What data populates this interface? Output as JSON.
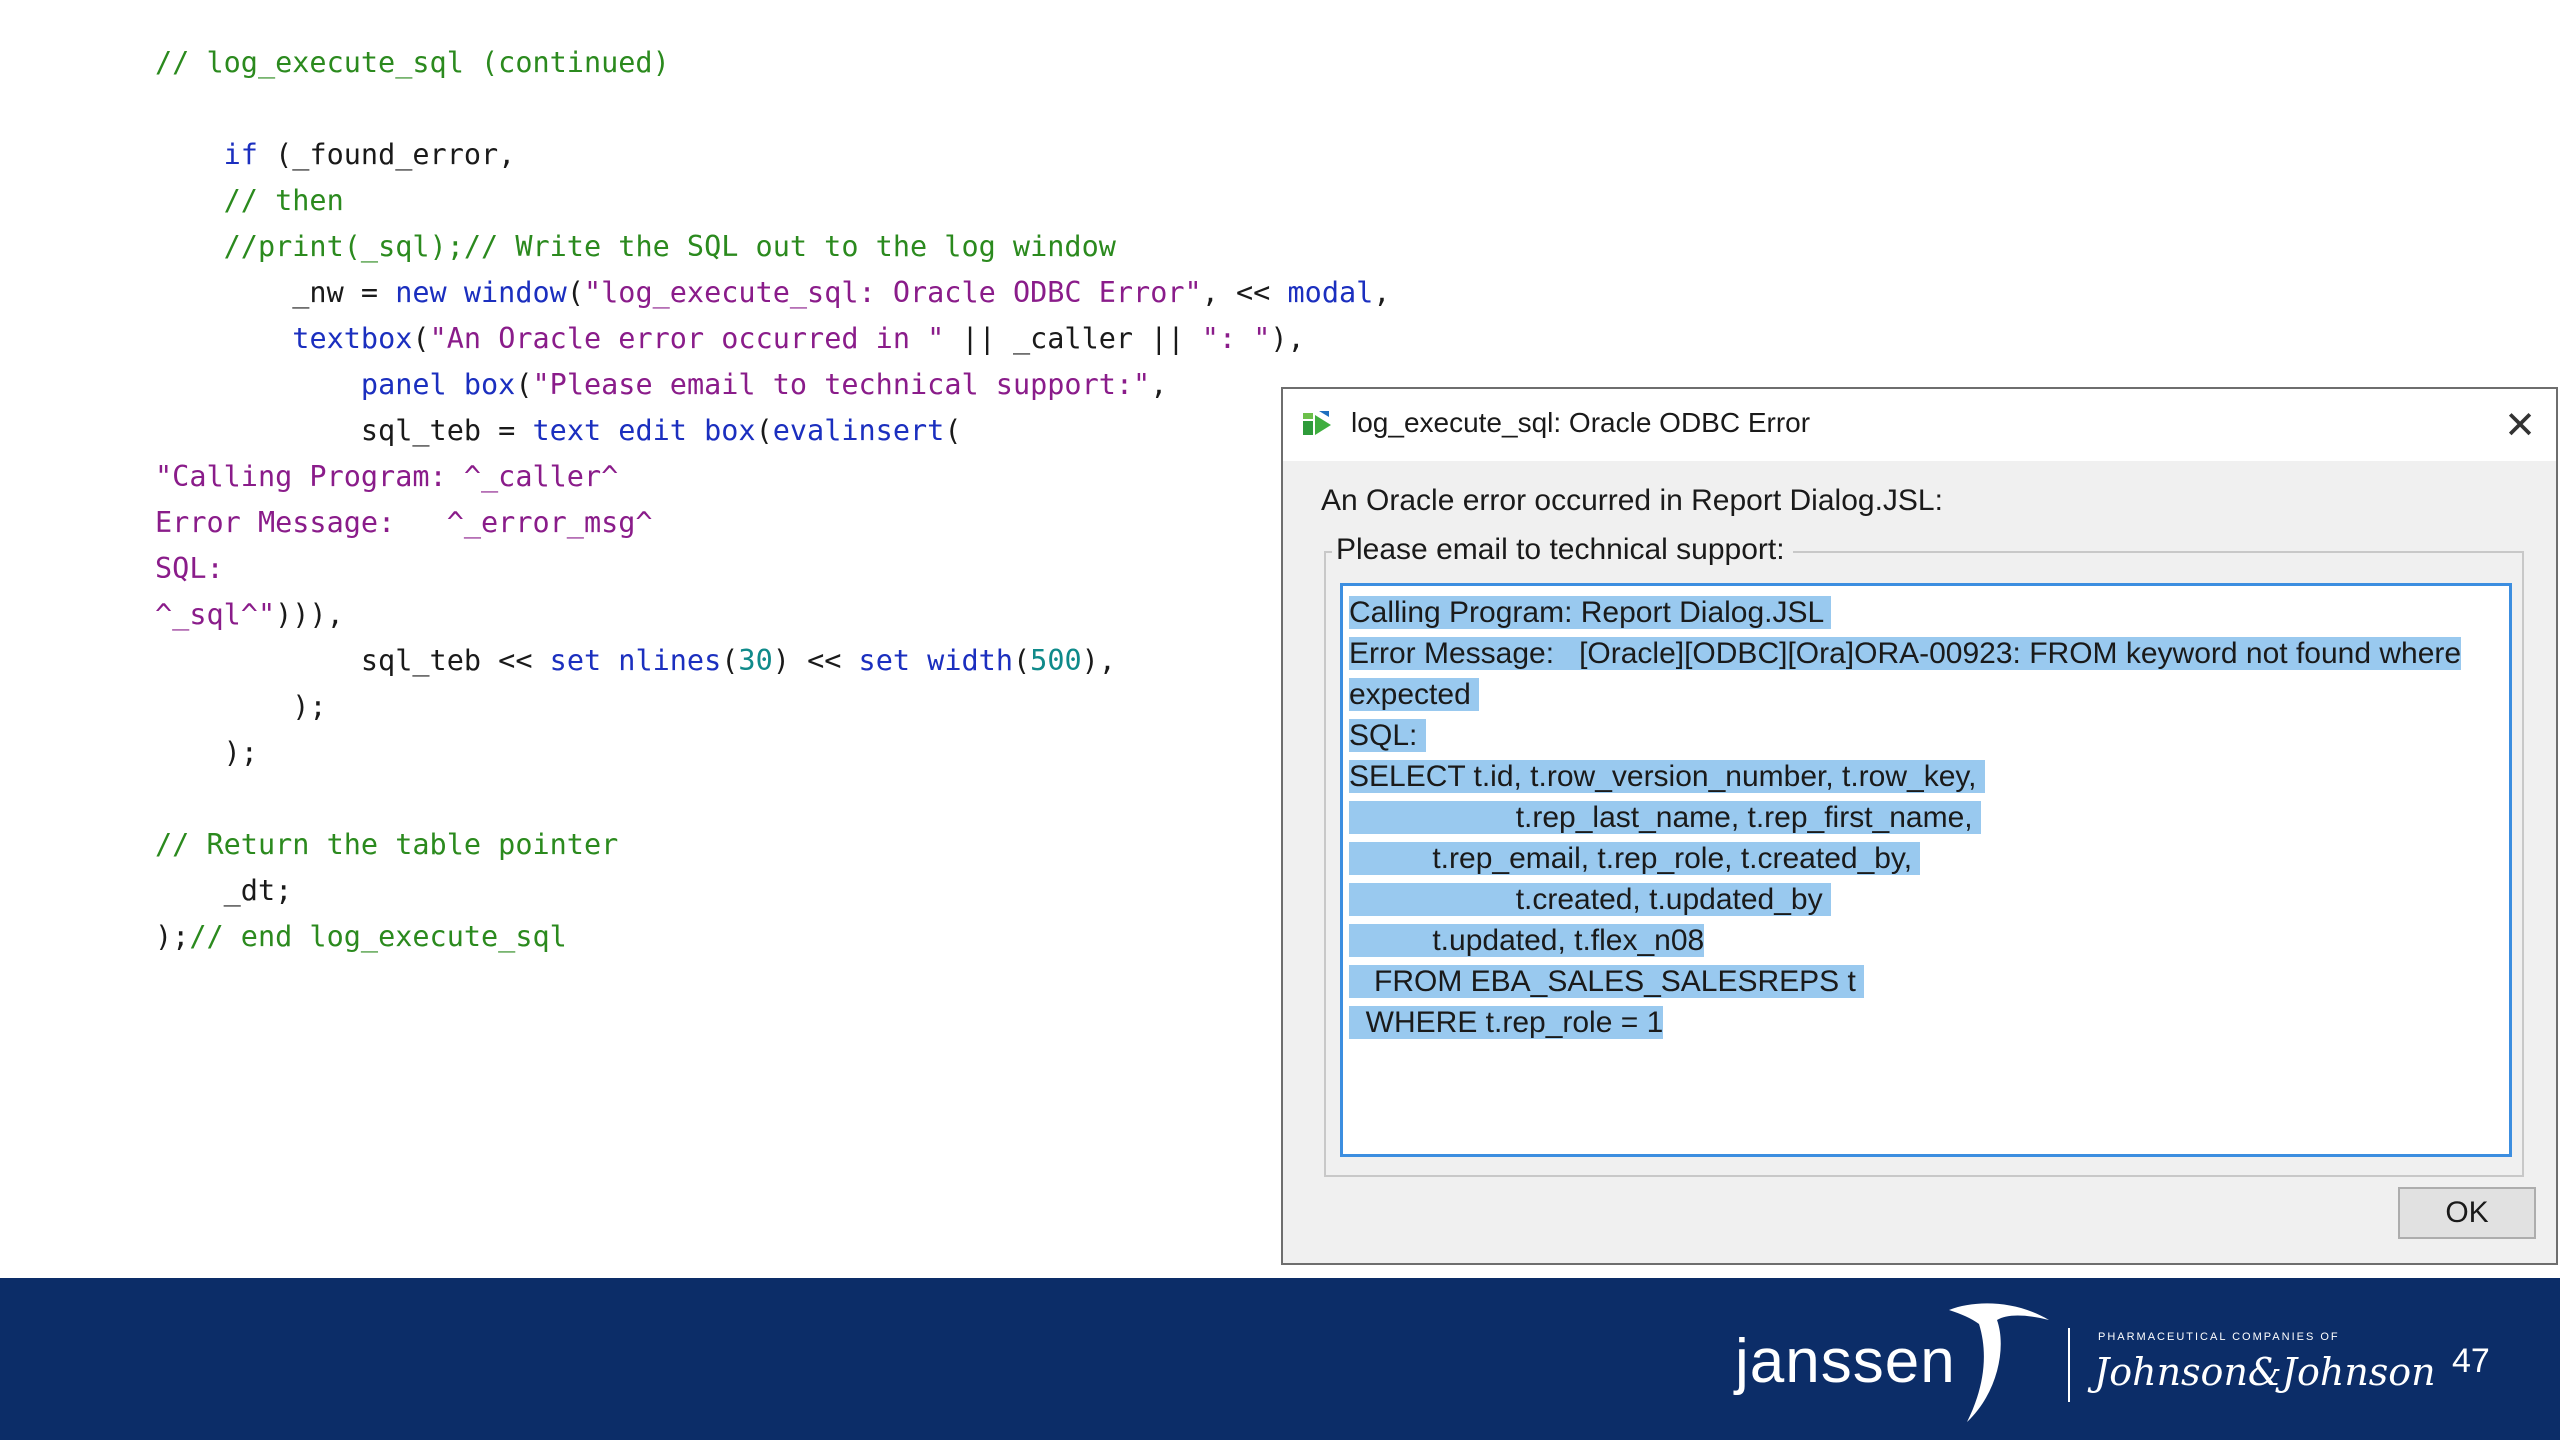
{
  "code": {
    "lines": [
      [
        {
          "t": "// log_execute_sql (continued)",
          "c": "cm"
        }
      ],
      [
        {
          "t": "",
          "c": ""
        }
      ],
      [
        {
          "t": "    ",
          "c": ""
        },
        {
          "t": "if",
          "c": "kw"
        },
        {
          "t": " (_found_error,",
          "c": ""
        }
      ],
      [
        {
          "t": "    ",
          "c": ""
        },
        {
          "t": "// then",
          "c": "cm"
        }
      ],
      [
        {
          "t": "    ",
          "c": ""
        },
        {
          "t": "//print(_sql);// Write the SQL out to the log window",
          "c": "cm"
        }
      ],
      [
        {
          "t": "        _nw = ",
          "c": ""
        },
        {
          "t": "new window",
          "c": "kw"
        },
        {
          "t": "(",
          "c": ""
        },
        {
          "t": "\"log_execute_sql: Oracle ODBC Error\"",
          "c": "st"
        },
        {
          "t": ", << ",
          "c": ""
        },
        {
          "t": "modal",
          "c": "kw"
        },
        {
          "t": ",",
          "c": ""
        }
      ],
      [
        {
          "t": "        ",
          "c": ""
        },
        {
          "t": "textbox",
          "c": "kw"
        },
        {
          "t": "(",
          "c": ""
        },
        {
          "t": "\"An Oracle error occurred in \"",
          "c": "st"
        },
        {
          "t": " || _caller || ",
          "c": ""
        },
        {
          "t": "\": \"",
          "c": "st"
        },
        {
          "t": "),",
          "c": ""
        }
      ],
      [
        {
          "t": "            ",
          "c": ""
        },
        {
          "t": "panel box",
          "c": "kw"
        },
        {
          "t": "(",
          "c": ""
        },
        {
          "t": "\"Please email to technical support:\"",
          "c": "st"
        },
        {
          "t": ",",
          "c": ""
        }
      ],
      [
        {
          "t": "            sql_teb = ",
          "c": ""
        },
        {
          "t": "text edit box",
          "c": "kw"
        },
        {
          "t": "(",
          "c": ""
        },
        {
          "t": "evalinsert",
          "c": "kw"
        },
        {
          "t": "(",
          "c": ""
        }
      ],
      [
        {
          "t": "\"Calling Program: ^_caller^",
          "c": "st"
        }
      ],
      [
        {
          "t": "Error Message:   ^_error_msg^",
          "c": "st"
        }
      ],
      [
        {
          "t": "SQL:",
          "c": "st"
        }
      ],
      [
        {
          "t": "^_sql^\"",
          "c": "st"
        },
        {
          "t": "))),",
          "c": ""
        }
      ],
      [
        {
          "t": "            sql_teb << ",
          "c": ""
        },
        {
          "t": "set nlines",
          "c": "kw"
        },
        {
          "t": "(",
          "c": ""
        },
        {
          "t": "30",
          "c": "nm"
        },
        {
          "t": ") << ",
          "c": ""
        },
        {
          "t": "set width",
          "c": "kw"
        },
        {
          "t": "(",
          "c": ""
        },
        {
          "t": "500",
          "c": "nm"
        },
        {
          "t": "),",
          "c": ""
        }
      ],
      [
        {
          "t": "        );",
          "c": ""
        }
      ],
      [
        {
          "t": "    );",
          "c": ""
        }
      ],
      [
        {
          "t": "",
          "c": ""
        }
      ],
      [
        {
          "t": "// Return the table pointer",
          "c": "cm"
        }
      ],
      [
        {
          "t": "    _dt;",
          "c": ""
        }
      ],
      [
        {
          "t": ");",
          "c": ""
        },
        {
          "t": "// end log_execute_sql",
          "c": "cm"
        }
      ]
    ]
  },
  "dialog": {
    "title": "log_execute_sql: Oracle ODBC Error",
    "close_glyph": "✕",
    "error_line": "An Oracle error occurred in Report Dialog.JSL:",
    "panel_label": "Please email to technical support:",
    "textbox_lines": [
      "Calling Program: Report Dialog.JSL ",
      "Error Message:   [Oracle][ODBC][Ora]ORA-00923: FROM keyword not found where",
      "expected ",
      "SQL: ",
      "SELECT t.id, t.row_version_number, t.row_key, ",
      "                    t.rep_last_name, t.rep_first_name, ",
      "          t.rep_email, t.rep_role, t.created_by, ",
      "                    t.created, t.updated_by ",
      "          t.updated, t.flex_n08",
      "   FROM EBA_SALES_SALESREPS t ",
      "  WHERE t.rep_role = 1"
    ],
    "ok_label": "OK",
    "app_icon": "jmp-script-icon"
  },
  "footer": {
    "brand": "janssen",
    "pharma_line": "PHARMACEUTICAL COMPANIES OF",
    "parent_brand": "Johnson&Johnson",
    "page_number": "47",
    "background_color": "#0c2d68"
  }
}
